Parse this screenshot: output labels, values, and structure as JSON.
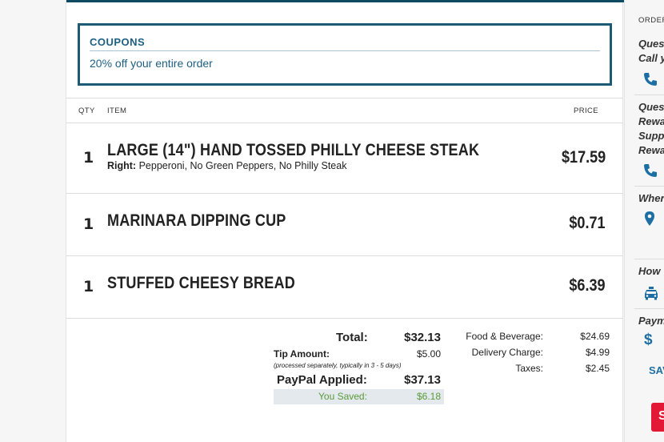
{
  "coupons": {
    "title": "COUPONS",
    "description": "20% off your entire order"
  },
  "order": {
    "headers": {
      "qty": "QTY",
      "item": "ITEM",
      "price": "PRICE"
    },
    "items": [
      {
        "qty": "1",
        "name": "LARGE (14\") HAND TOSSED PHILLY CHEESE STEAK",
        "options_label": "Right:",
        "options": "Pepperoni, No Green Peppers, No Philly Steak",
        "price": "$17.59"
      },
      {
        "qty": "1",
        "name": "MARINARA DIPPING CUP",
        "price": "$0.71"
      },
      {
        "qty": "1",
        "name": "STUFFED CHEESY BREAD",
        "price": "$6.39"
      }
    ]
  },
  "summary": {
    "total_label": "Total:",
    "total_value": "$32.13",
    "tip_label": "Tip Amount:",
    "tip_value": "$5.00",
    "tip_note": "(processed separately, typically in 3 - 5 days)",
    "paypal_label": "PayPal Applied:",
    "paypal_value": "$37.13",
    "saved_label": "You Saved:",
    "saved_value": "$6.18",
    "food_label": "Food & Beverage:",
    "food_value": "$24.69",
    "delivery_label": "Delivery Charge:",
    "delivery_value": "$4.99",
    "taxes_label": "Taxes:",
    "taxes_value": "$2.45"
  },
  "sidebar": {
    "header": "ORDER",
    "q1_line1": "Ques",
    "q1_line2": "Call y",
    "q2_line1": "Ques",
    "q2_line2": "Rewa",
    "q2_line3": "Supp",
    "q2_line4": "Rewa",
    "where": "Wher",
    "how": "How",
    "payment": "Paym",
    "save": "SAV",
    "button_letter": "S"
  },
  "colors": {
    "brand_blue": "#1d5f82",
    "saved_green": "#5a9a3a",
    "red": "#e31837",
    "icon_blue": "#1d6fa3"
  }
}
